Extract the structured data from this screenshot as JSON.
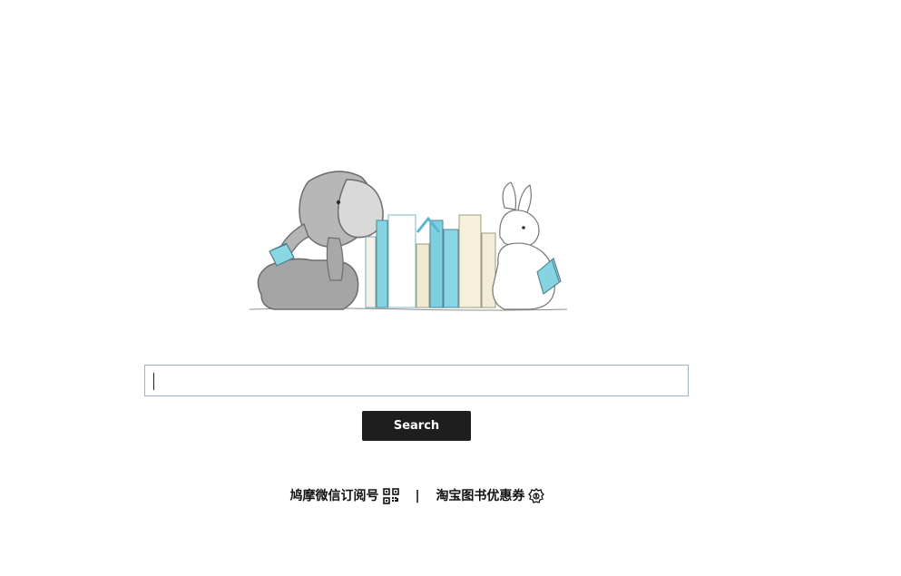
{
  "search": {
    "placeholder": "",
    "value": ""
  },
  "actions": {
    "search_label": "Search"
  },
  "footer": {
    "wechat_label": "鸠摩微信订阅号",
    "separator": "|",
    "taobao_label": "淘宝图书优惠券"
  },
  "illustration": {
    "subject": "elephant-reading-book-bunny-reading-bookshelf",
    "accent_colors": [
      "#7fd2e2",
      "#f3ecd8",
      "#ffffff",
      "#8e8e8e"
    ]
  },
  "icons": {
    "qr": "qr-code-icon",
    "badge": "coupon-badge-icon"
  }
}
